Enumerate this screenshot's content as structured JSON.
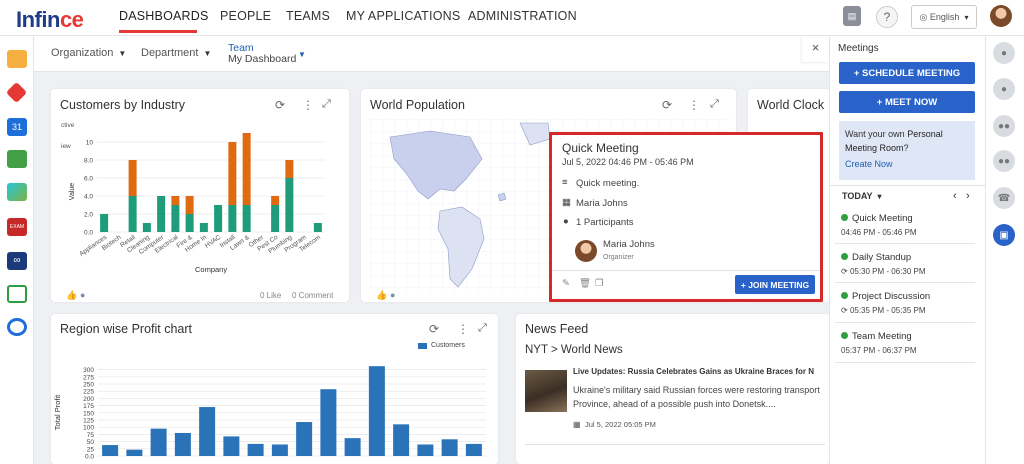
{
  "brand": {
    "logo_part1": "Infin",
    "logo_part2": "ce"
  },
  "nav": [
    {
      "label": "DASHBOARDS"
    },
    {
      "label": "PEOPLE"
    },
    {
      "label": "TEAMS"
    },
    {
      "label": "MY APPLICATIONS"
    },
    {
      "label": "ADMINISTRATION"
    }
  ],
  "top": {
    "language": "English"
  },
  "filters": {
    "organization": "Organization",
    "department": "Department",
    "team": "Team",
    "team_value": "My Dashboard"
  },
  "customers_card": {
    "title": "Customers by Industry",
    "legend": [
      "ctive",
      "iew"
    ],
    "ylabel": "Value",
    "xlabel": "Company",
    "like": "0 Like",
    "comment": "0 Comment",
    "chart_data": {
      "type": "bar",
      "categories": [
        "Appliances",
        "Biotech",
        "Retail",
        "Cleaning",
        "Computer",
        "Electrical",
        "Fire &",
        "Home In",
        "HVAC",
        "Install",
        "Lawn &",
        "Other",
        "Pest Co",
        "Plumbing",
        "Program",
        "Telecom"
      ],
      "ylim": [
        0,
        10
      ],
      "yticks": [
        0,
        2,
        4,
        6,
        8,
        10
      ],
      "tick_labels": [
        "0.0",
        "2.0",
        "4.0",
        "6.0",
        "8.0",
        "10"
      ],
      "x_tick_labels": [
        "Appliances",
        "Biotech",
        "Retail",
        "Cleaning",
        "Computer",
        "Electrical",
        "Fire &",
        "Home In",
        "HVAC",
        "Install",
        "Lawn &",
        "Other",
        "Pest Co",
        "Plumbing",
        "Program",
        "Telecom"
      ],
      "series": [
        {
          "name": "ctive",
          "color": "#1f9c7a",
          "values": [
            2,
            0,
            4,
            1,
            4,
            3,
            2,
            1,
            3,
            3,
            3,
            0,
            3,
            6,
            0,
            1
          ]
        },
        {
          "name": "iew",
          "color": "#e06a12",
          "values": [
            0,
            0,
            4,
            0,
            0,
            1,
            2,
            0,
            0,
            7,
            8,
            0,
            1,
            2,
            0,
            0
          ]
        }
      ]
    }
  },
  "population_card": {
    "title": "World Population"
  },
  "clock_card": {
    "title": "World Clock"
  },
  "popup": {
    "title": "Quick Meeting",
    "datetime": "Jul 5, 2022 04:46 PM - 05:46 PM",
    "description": "Quick meeting.",
    "organizer_line": "Maria Johns",
    "participants": "1 Participants",
    "person_name": "Maria Johns",
    "person_role": "Organizer",
    "join_label": "+ JOIN MEETING"
  },
  "profit_card": {
    "title": "Region wise Profit chart",
    "ylabel": "Total Profit",
    "chart_data": {
      "type": "bar",
      "series": [
        {
          "name": "Customers",
          "color": "#2a73b8",
          "values": [
            38,
            22,
            95,
            80,
            170,
            68,
            42,
            40,
            118,
            232,
            62,
            312,
            110,
            40,
            58,
            42
          ]
        }
      ],
      "ylim": [
        0,
        330
      ],
      "yticks": [
        0,
        25,
        50,
        75,
        100,
        125,
        150,
        175,
        200,
        225,
        250,
        275,
        300
      ],
      "tick_labels": [
        "0.0",
        "25",
        "50",
        "75",
        "100",
        "125",
        "150",
        "175",
        "200",
        "225",
        "250",
        "275",
        "300"
      ]
    }
  },
  "news_card": {
    "title": "News Feed",
    "source": "NYT > World News",
    "headline": "Live Updates: Russia Celebrates Gains as Ukraine Braces for N",
    "body": "Ukraine's military said Russian forces were restoring transport Province, ahead of a possible push into Donetsk....",
    "date": "Jul 5, 2022 05:05 PM"
  },
  "meetings": {
    "title": "Meetings",
    "schedule_label": "+ SCHEDULE MEETING",
    "meetnow_label": "+ MEET NOW",
    "promo_1": "Want your own ",
    "promo_2": "Personal Meeting Room",
    "promo_3": "?",
    "create_now": "Create Now",
    "day": "TODAY",
    "items": [
      {
        "title": "Quick Meeting",
        "time": "04:46 PM - 05:46 PM"
      },
      {
        "title": "Daily Standup",
        "time": "05:30 PM - 06:30 PM"
      },
      {
        "title": "Project Discussion",
        "time": "05:35 PM - 05:35 PM"
      },
      {
        "title": "Team Meeting",
        "time": "05:37 PM - 06:37 PM"
      }
    ]
  }
}
